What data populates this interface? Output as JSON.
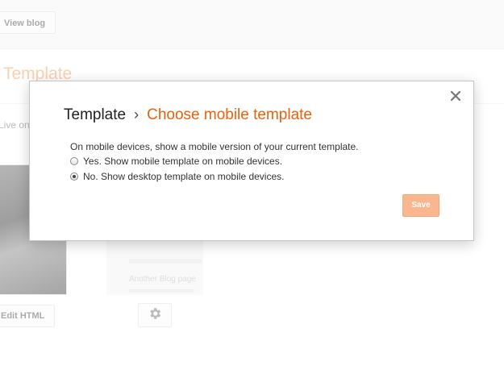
{
  "background": {
    "view_blog_label": "View blog",
    "page_title": "Template",
    "custom_text": "Live on Blog / Customize",
    "mobile_preview_text": "Another Blog page",
    "edit_html_label": "Edit HTML"
  },
  "dialog": {
    "breadcrumb_parent": "Template",
    "breadcrumb_separator": "›",
    "breadcrumb_current": "Choose mobile template",
    "close_label": "×",
    "question": "On mobile devices, show a mobile version of your current template.",
    "options": [
      {
        "label": "Yes. Show mobile template on mobile devices.",
        "selected": false
      },
      {
        "label": "No. Show desktop template on mobile devices.",
        "selected": true
      }
    ],
    "save_label": "Save"
  },
  "colors": {
    "accent": "#e8620c",
    "save_button": "#f9b68f"
  },
  "icons": {
    "close": "close-icon",
    "gear": "gear-icon"
  }
}
